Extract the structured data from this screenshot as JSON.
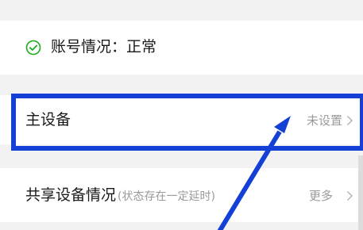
{
  "status": {
    "icon": "check-circle-icon",
    "text": "账号情况：正常",
    "color": "#1aad19"
  },
  "primary_device": {
    "label": "主设备",
    "value": "未设置"
  },
  "shared_devices": {
    "label": "共享设备情况",
    "note": "(状态存在一定延时)",
    "value": "更多"
  },
  "annotation": {
    "color": "#1440d6"
  }
}
